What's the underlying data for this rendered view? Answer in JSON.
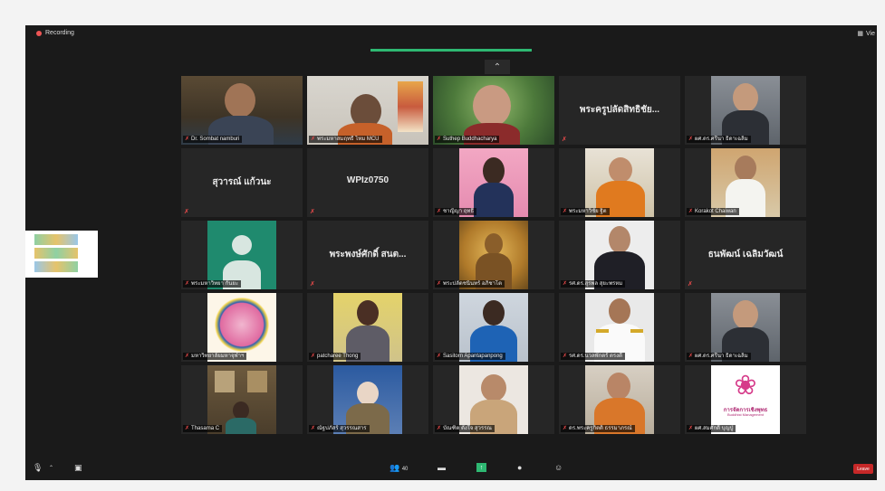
{
  "recording": {
    "label": "Recording"
  },
  "view": {
    "label": "Vie"
  },
  "participants_count": "40",
  "leave_label": "Leave",
  "tiles": [
    {
      "kind": "video",
      "name": "Dr. Sombat namburi"
    },
    {
      "kind": "video",
      "name": "พระมหาสมฤทธิ์ ไหม MCU"
    },
    {
      "kind": "video",
      "name": "Suthep Buddhacharya"
    },
    {
      "kind": "name",
      "display": "พระครูปลัดสิทธิชัย...",
      "name": ""
    },
    {
      "kind": "video",
      "name": "ผศ.ดร.ศรีนา ธิดาเฉลิม"
    },
    {
      "kind": "name",
      "display": "สุวารณ์ แก้วนะ",
      "name": ""
    },
    {
      "kind": "name",
      "display": "WPIz0750",
      "name": ""
    },
    {
      "kind": "video",
      "name": "ชาญิญา ฤทธิ์"
    },
    {
      "kind": "video",
      "name": "พระมหาวิชัย ฐิต"
    },
    {
      "kind": "video",
      "name": "Korakot Chaiwan"
    },
    {
      "kind": "avatar",
      "name": "พระมหาวิทยา กันยะ"
    },
    {
      "kind": "name",
      "display": "พระพงษ์ศักดิ์ สนต...",
      "name": ""
    },
    {
      "kind": "video",
      "name": "พระปลัดชนินทร์ อภิชาโต"
    },
    {
      "kind": "video",
      "name": "รศ.ดร.สุรพล สุยะพรหม"
    },
    {
      "kind": "name",
      "display": "ธนพัฒน์ เฉลิมวัฒน์",
      "name": ""
    },
    {
      "kind": "video",
      "name": "มหาวิทยาลัยมหาจุฬาฯ"
    },
    {
      "kind": "video",
      "name": "patcharee Thong"
    },
    {
      "kind": "video",
      "name": "Sasitorn Apantapanpong"
    },
    {
      "kind": "video",
      "name": "รศ.ดร.นวลพักตร์ ตรงดี"
    },
    {
      "kind": "video",
      "name": "ผศ.ดร.ศรีนา ธิดาเฉลิม"
    },
    {
      "kind": "video",
      "name": "Thasama C"
    },
    {
      "kind": "video",
      "name": "ณัฐปภัสร์ สุวรรณสาร"
    },
    {
      "kind": "video",
      "name": "บัณฑิต ตั้งใจ สุวรรณ"
    },
    {
      "kind": "video",
      "name": "ดร.พระครูกิตติ ธรรมาภรณ์"
    },
    {
      "kind": "logo",
      "name": "ผศ.สมศักดิ์ บุญปู่",
      "logo_title": "การจัดการเชิงพุทธ",
      "logo_subtitle": "Buddhist Management"
    }
  ],
  "colors": {
    "window_bg": "#1a1a1a",
    "tile_bg": "#262626",
    "active_speaker": "#8dbb3c",
    "muted_icon": "#e84a4a",
    "leave": "#c62828"
  }
}
